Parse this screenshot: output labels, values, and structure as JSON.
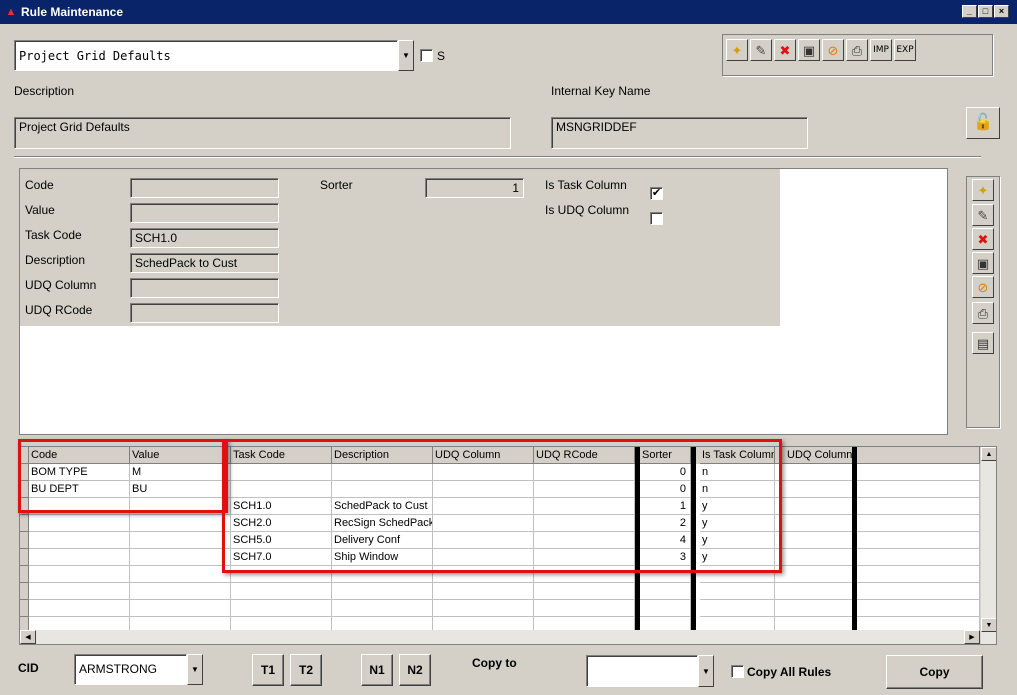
{
  "window": {
    "title": "Rule Maintenance",
    "min": "_",
    "max": "□",
    "close": "×"
  },
  "top": {
    "rule_select": "Project Grid Defaults",
    "s_label": "S",
    "toolbar": {
      "imp": "IMP",
      "exp": "EXP"
    },
    "description_label": "Description",
    "description_value": "Project Grid Defaults",
    "internal_key_label": "Internal Key Name",
    "internal_key_value": "MSNGRIDDEF"
  },
  "form": {
    "code_label": "Code",
    "code_value": "",
    "value_label": "Value",
    "value_value": "",
    "task_code_label": "Task Code",
    "task_code_value": "SCH1.0",
    "description_label": "Description",
    "description_value": "SchedPack to Cust",
    "udq_column_label": "UDQ Column",
    "udq_column_value": "",
    "udq_rcode_label": "UDQ RCode",
    "udq_rcode_value": "",
    "sorter_label": "Sorter",
    "sorter_value": "1",
    "is_task_column_label": "Is Task Column",
    "is_task_column_checked": true,
    "is_udq_column_label": "Is UDQ Column",
    "is_udq_column_checked": false
  },
  "grid": {
    "headers": [
      "Code",
      "Value",
      "Task Code",
      "Description",
      "UDQ Column",
      "UDQ RCode",
      "Sorter",
      "Is Task Column",
      "UDQ Column"
    ],
    "rows": [
      [
        "BOM TYPE",
        "M",
        "",
        "",
        "",
        "",
        "0",
        "n",
        ""
      ],
      [
        "BU DEPT",
        "BU",
        "",
        "",
        "",
        "",
        "0",
        "n",
        ""
      ],
      [
        "",
        "",
        "SCH1.0",
        "SchedPack to Cust",
        "",
        "",
        "1",
        "y",
        ""
      ],
      [
        "",
        "",
        "SCH2.0",
        "RecSign SchedPack",
        "",
        "",
        "2",
        "y",
        ""
      ],
      [
        "",
        "",
        "SCH5.0",
        "Delivery Conf",
        "",
        "",
        "4",
        "y",
        ""
      ],
      [
        "",
        "",
        "SCH7.0",
        "Ship Window",
        "",
        "",
        "3",
        "y",
        ""
      ]
    ]
  },
  "bottom": {
    "cid_label": "CID",
    "cid_value": "ARMSTRONG",
    "t1": "T1",
    "t2": "T2",
    "n1": "N1",
    "n2": "N2",
    "copy_to_label": "Copy to",
    "copy_to_value": "",
    "copy_all_rules_label": "Copy All Rules",
    "copy_button": "Copy"
  }
}
